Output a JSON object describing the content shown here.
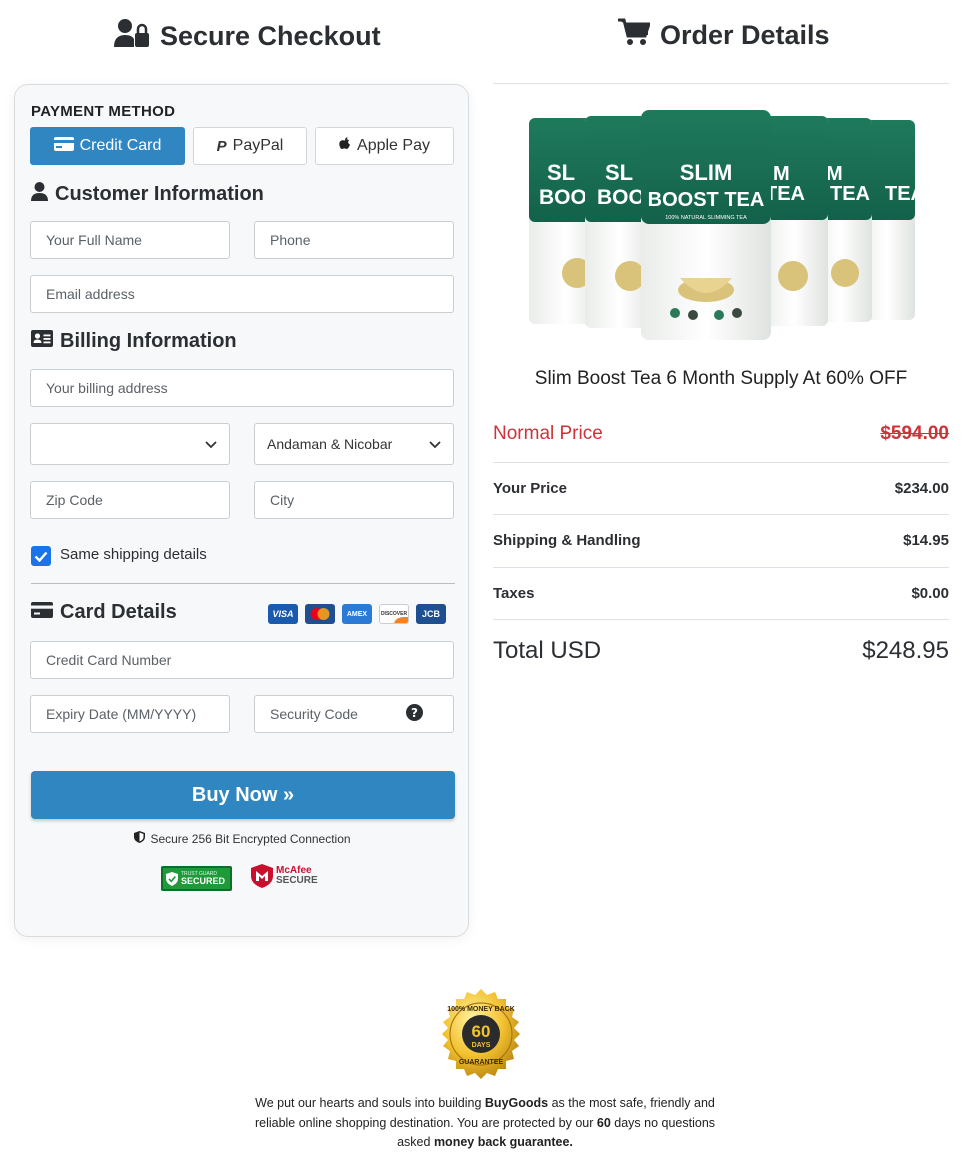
{
  "left_header": {
    "title": "Secure Checkout"
  },
  "right_header": {
    "title": "Order Details"
  },
  "payment": {
    "section_label": "PAYMENT METHOD",
    "methods": [
      {
        "label": "Credit Card",
        "active": true
      },
      {
        "label": "PayPal",
        "active": false
      },
      {
        "label": "Apple Pay",
        "active": false
      }
    ]
  },
  "customer": {
    "title": "Customer Information",
    "name_placeholder": "Your Full Name",
    "phone_placeholder": "Phone",
    "email_placeholder": "Email address"
  },
  "billing": {
    "title": "Billing Information",
    "address_placeholder": "Your billing address",
    "country_value": "",
    "state_value": "Andaman & Nicobar",
    "zip_placeholder": "Zip Code",
    "city_placeholder": "City",
    "same_shipping_label": "Same shipping details",
    "same_shipping_checked": true
  },
  "card": {
    "title": "Card Details",
    "logos": [
      "VISA",
      "MC",
      "AMEX",
      "DISCOVER",
      "JCB"
    ],
    "number_placeholder": "Credit Card Number",
    "expiry_placeholder": "Expiry Date (MM/YYYY)",
    "cvv_placeholder": "Security Code"
  },
  "buy_button": {
    "label": "Buy Now »"
  },
  "secure_text": "Secure 256 Bit Encrypted Connection",
  "badges": {
    "trustguard_top": "TRUST GUARD",
    "trustguard_main": "SECURED",
    "mcafee_top": "McAfee",
    "mcafee_main": "SECURE"
  },
  "product": {
    "name": "Slim Boost Tea 6 Month Supply At 60% OFF",
    "pouch_title_1": "SLIM",
    "pouch_title_2": "BOOST TEA",
    "pouch_sub": "100% NATURAL SLIMMING TEA",
    "back_1": "SL",
    "back_2": "BOOS",
    "back_3": "M",
    "back_4": "TEA"
  },
  "pricing": {
    "normal_label": "Normal Price",
    "normal_value": "$594.00",
    "your_label": "Your Price",
    "your_value": "$234.00",
    "shipping_label": "Shipping & Handling",
    "shipping_value": "$14.95",
    "taxes_label": "Taxes",
    "taxes_value": "$0.00",
    "total_label": "Total USD",
    "total_value": "$248.95"
  },
  "guarantee": {
    "seal_top": "100% MONEY BACK",
    "seal_num": "60",
    "seal_days": "DAYS",
    "seal_bottom": "GUARANTEE",
    "text_a": "We put our hearts and souls into building ",
    "text_b": "BuyGoods",
    "text_c": " as the most safe, friendly and reliable online shopping destination. You are protected by our ",
    "text_d": "60",
    "text_e": " days no questions asked ",
    "text_f": "money back guarantee."
  },
  "colors": {
    "accent": "#2f86c0",
    "normal_price": "#d0323a",
    "checkbox": "#1a73e8"
  }
}
